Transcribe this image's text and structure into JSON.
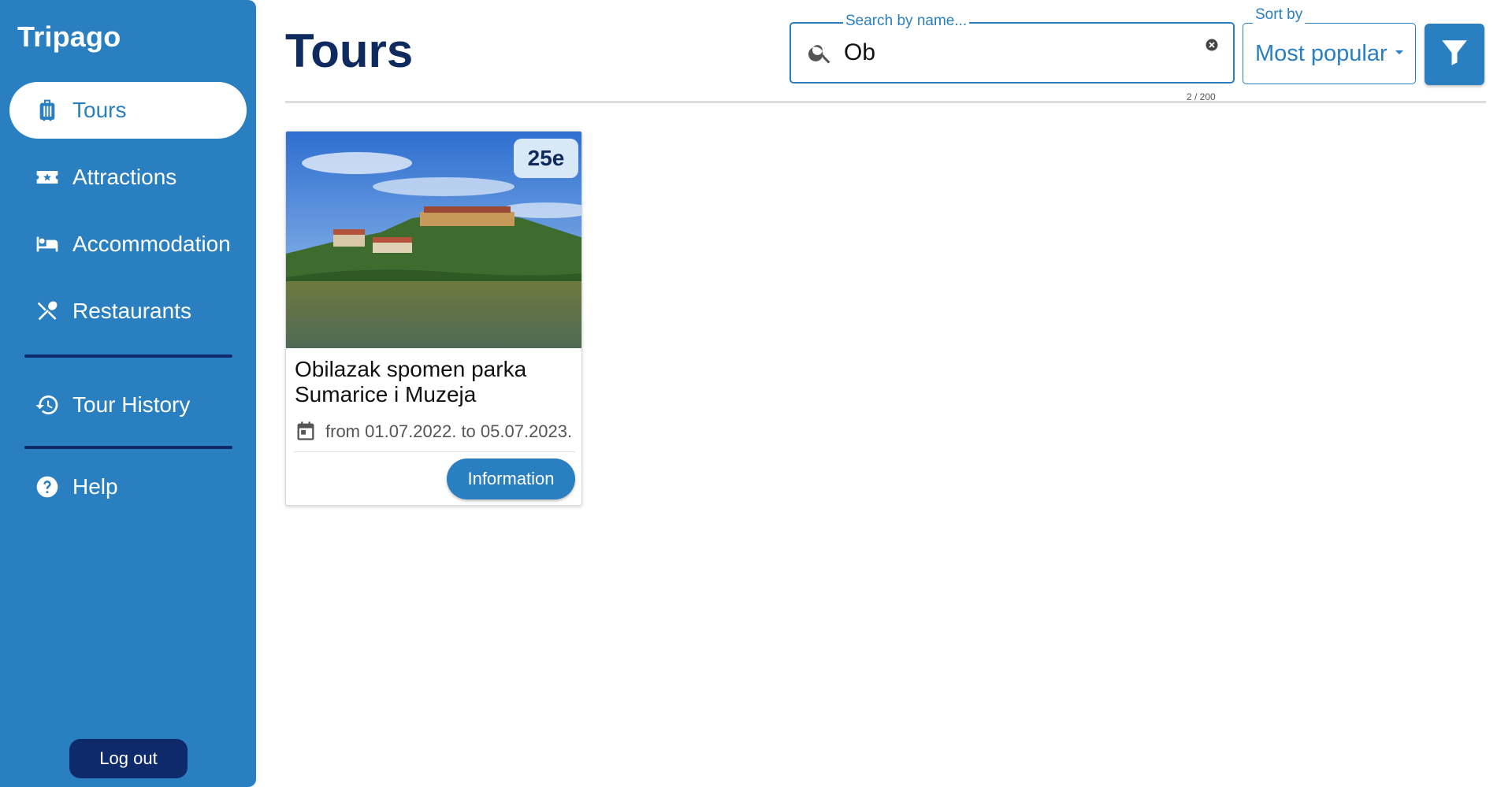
{
  "sidebar": {
    "brand": "Tripago",
    "items": [
      {
        "label": "Tours",
        "icon": "luggage-icon",
        "active": true
      },
      {
        "label": "Attractions",
        "icon": "ticket-star-icon",
        "active": false
      },
      {
        "label": "Accommodation",
        "icon": "bed-icon",
        "active": false
      },
      {
        "label": "Restaurants",
        "icon": "utensils-icon",
        "active": false
      },
      {
        "label": "Tour History",
        "icon": "history-icon",
        "active": false
      },
      {
        "label": "Help",
        "icon": "help-circle-icon",
        "active": false
      }
    ],
    "logout_label": "Log out"
  },
  "header": {
    "title": "Tours",
    "search": {
      "label": "Search by name...",
      "value": "Ob",
      "counter": "2 / 200"
    },
    "sort": {
      "label": "Sort by",
      "value": "Most popular"
    },
    "filter_icon": "funnel-icon"
  },
  "tours": [
    {
      "price": "25e",
      "title": "Obilazak spomen parka Sumarice i Muzeja",
      "dates": "from 01.07.2022. to 05.07.2023.",
      "button_label": "Information"
    }
  ],
  "colors": {
    "primary": "#2a7fc0",
    "navy": "#0f2a6b",
    "title": "#0f2a5e",
    "badge_bg": "#d8e8f7"
  }
}
